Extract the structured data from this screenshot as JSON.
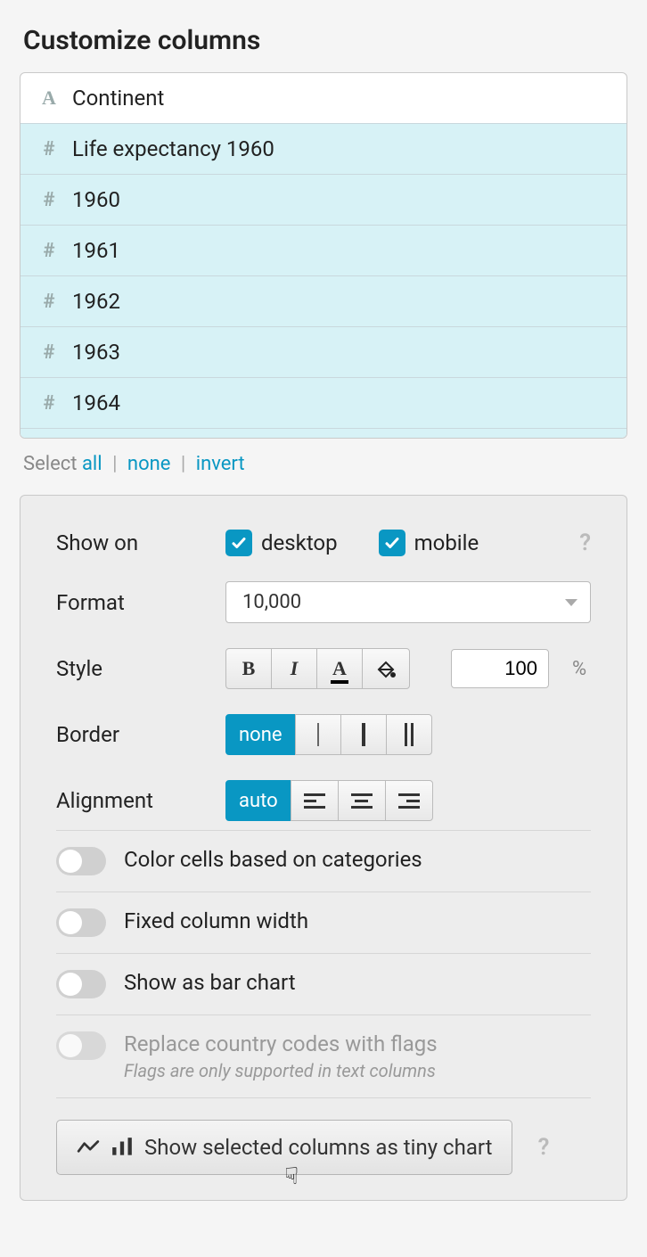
{
  "heading": "Customize columns",
  "columns": [
    {
      "type": "text",
      "label": "Continent",
      "selected": false
    },
    {
      "type": "num",
      "label": "Life expectancy 1960",
      "selected": true
    },
    {
      "type": "num",
      "label": "1960",
      "selected": true
    },
    {
      "type": "num",
      "label": "1961",
      "selected": true
    },
    {
      "type": "num",
      "label": "1962",
      "selected": true
    },
    {
      "type": "num",
      "label": "1963",
      "selected": true
    },
    {
      "type": "num",
      "label": "1964",
      "selected": true
    }
  ],
  "select_row": {
    "prefix": "Select",
    "all": "all",
    "none": "none",
    "invert": "invert"
  },
  "form": {
    "show_on": {
      "label": "Show on",
      "desktop": "desktop",
      "mobile": "mobile"
    },
    "format": {
      "label": "Format",
      "value": "10,000"
    },
    "style": {
      "label": "Style",
      "bold": "B",
      "italic": "I",
      "color": "A",
      "width_value": "100",
      "width_unit": "%"
    },
    "border": {
      "label": "Border",
      "none": "none"
    },
    "alignment": {
      "label": "Alignment",
      "auto": "auto"
    }
  },
  "toggles": {
    "color_cells": "Color cells based on categories",
    "fixed_width": "Fixed column width",
    "bar_chart": "Show as bar chart",
    "flags": "Replace country codes with flags",
    "flags_sub": "Flags are only supported in text columns"
  },
  "tiny_chart_button": "Show selected columns as tiny chart"
}
